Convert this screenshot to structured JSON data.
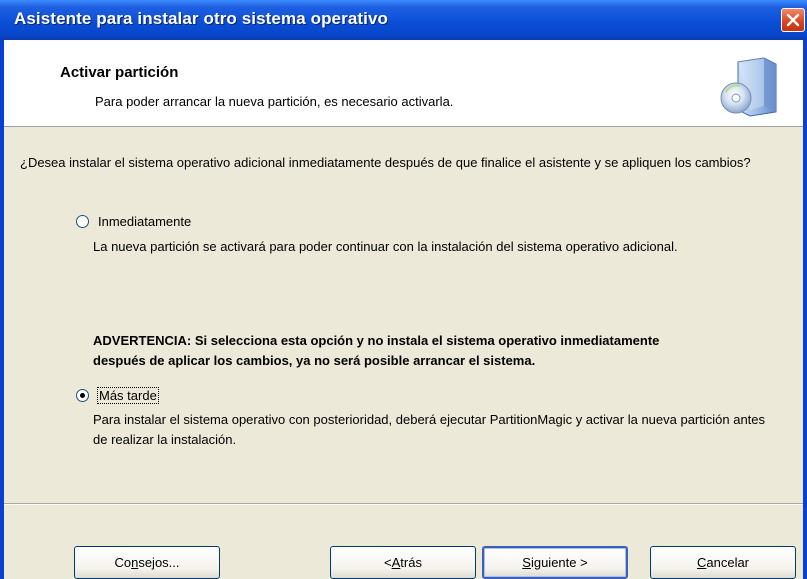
{
  "window": {
    "title": "Asistente para instalar otro sistema operativo",
    "close_icon": "close-icon"
  },
  "header": {
    "title": "Activar partición",
    "subtitle": "Para poder arrancar la nueva partición, es necesario activarla.",
    "icon": "computer-disc-icon"
  },
  "body": {
    "question": "¿Desea instalar el sistema operativo adicional inmediatamente después de que finalice el asistente y se apliquen los cambios?",
    "options": [
      {
        "label": "Inmediatamente",
        "checked": false,
        "description": "La nueva partición se activará para poder continuar con la instalación del sistema operativo adicional."
      },
      {
        "label": "Más tarde",
        "checked": true,
        "description": "Para instalar el sistema operativo con posterioridad, deberá ejecutar PartitionMagic y activar la nueva partición antes de realizar la instalación."
      }
    ],
    "warning": "ADVERTENCIA:  Si selecciona esta opción y no instala el sistema operativo inmediatamente después de aplicar los cambios, ya no será posible arrancar el sistema."
  },
  "buttons": {
    "tips": {
      "pre": "Co",
      "key": "n",
      "post": "sejos..."
    },
    "back": {
      "pre": "< ",
      "key": "A",
      "post": "trás"
    },
    "next": {
      "pre": "",
      "key": "S",
      "post": "iguiente >"
    },
    "cancel": {
      "pre": "",
      "key": "C",
      "post": "ancelar"
    }
  }
}
